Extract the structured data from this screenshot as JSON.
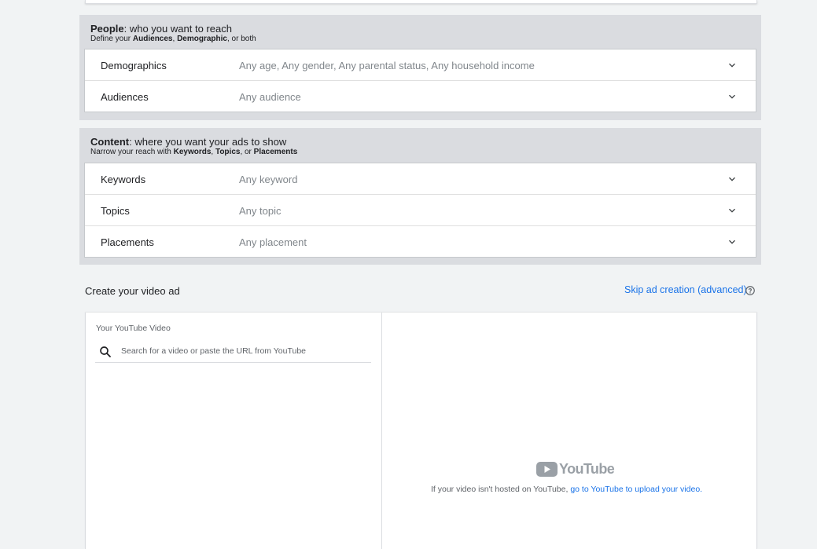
{
  "people": {
    "title_bold": "People",
    "title_rest": ": who you want to reach",
    "sub_prefix": "Define your ",
    "sub_audiences": "Audiences",
    "sub_comma": ", ",
    "sub_demographic": "Demographic",
    "sub_suffix": ", or both",
    "rows": [
      {
        "label": "Demographics",
        "value": "Any age, Any gender, Any parental status, Any household income"
      },
      {
        "label": "Audiences",
        "value": "Any audience"
      }
    ]
  },
  "content": {
    "title_bold": "Content",
    "title_rest": ": where you want your ads to show",
    "sub_prefix": "Narrow your reach with ",
    "sub_keywords": "Keywords",
    "sub_comma1": ", ",
    "sub_topics": "Topics",
    "sub_or": ", or ",
    "sub_placements": "Placements",
    "rows": [
      {
        "label": "Keywords",
        "value": "Any keyword"
      },
      {
        "label": "Topics",
        "value": "Any topic"
      },
      {
        "label": "Placements",
        "value": "Any placement"
      }
    ]
  },
  "video_ad": {
    "title": "Create your video ad",
    "skip_link": "Skip ad creation (advanced)",
    "help_icon": "help-circle-icon",
    "left": {
      "label": "Your YouTube Video",
      "search_placeholder": "Search for a video or paste the URL from YouTube",
      "search_value": ""
    },
    "right": {
      "logo_text": "YouTube",
      "note_text": "If your video isn't hosted on YouTube, ",
      "note_link": "go to YouTube to upload your video."
    }
  },
  "icons": {
    "expand": "chevron-down-icon",
    "search": "search-icon",
    "logo": "youtube-logo-icon"
  },
  "colors": {
    "link": "#1a73e8",
    "section_bg": "#dadce0",
    "page_bg": "#f1f3f4",
    "muted_text": "#80868b",
    "logo_gray": "#9aa0a6"
  }
}
